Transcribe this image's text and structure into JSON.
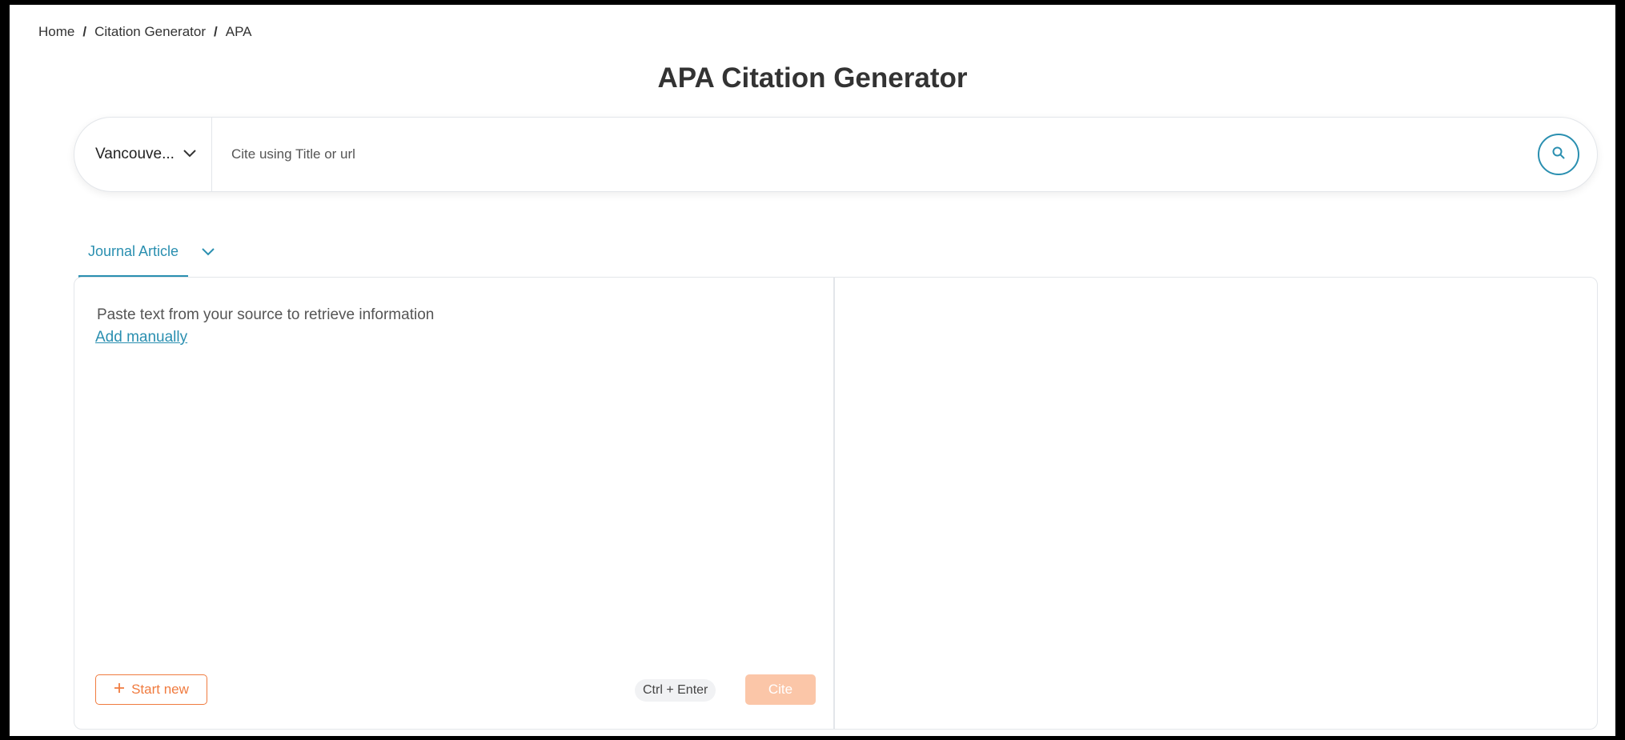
{
  "breadcrumb": {
    "items": [
      "Home",
      "Citation Generator",
      "APA"
    ],
    "separator": "/"
  },
  "page_title": "APA Citation Generator",
  "search": {
    "style_selected": "Vancouve...",
    "placeholder": "Cite using Title or url",
    "icon": "search-icon"
  },
  "tabs": {
    "active_label": "Journal Article",
    "dropdown_icon": "chevron-down-icon"
  },
  "editor": {
    "hint": "Paste text from your source to retrieve information",
    "add_manually": "Add manually",
    "start_new": "Start new",
    "shortcut": "Ctrl + Enter",
    "cite": "Cite"
  },
  "colors": {
    "accent": "#2a8fb0",
    "orange": "#f07b3f",
    "cite_disabled": "#fbc6a8"
  }
}
